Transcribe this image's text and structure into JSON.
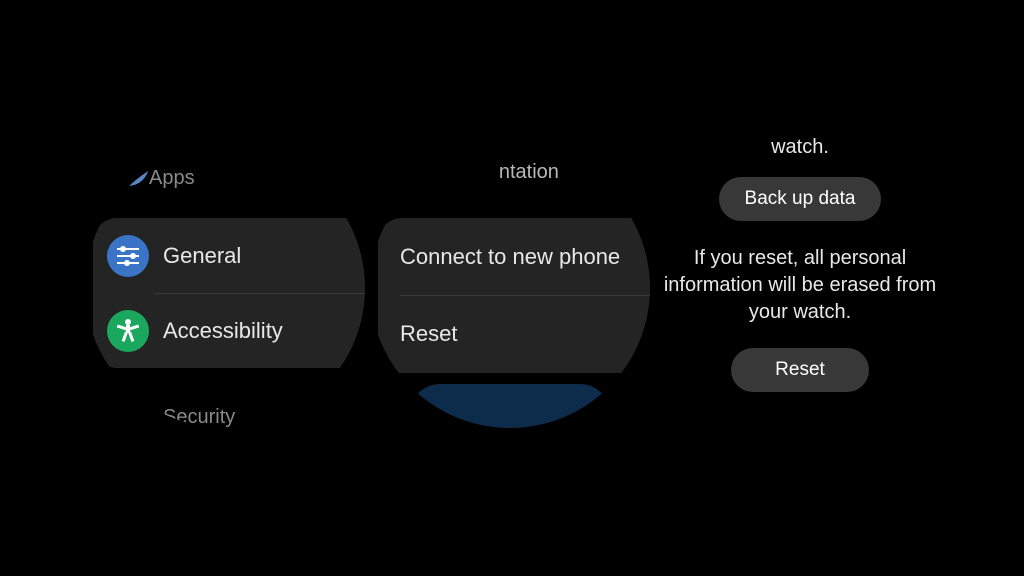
{
  "watch1": {
    "apps_label": "Apps",
    "general_label": "General",
    "accessibility_label": "Accessibility",
    "security_label": "Security",
    "icons": {
      "apps": "apps-icon",
      "general": "sliders-icon",
      "accessibility": "accessibility-icon",
      "security": "lock-icon"
    }
  },
  "watch2": {
    "top_partial": "ntation",
    "connect_label": "Connect to new phone",
    "reset_label": "Reset"
  },
  "watch3": {
    "top_fragment": "watch.",
    "backup_btn": "Back up data",
    "warning_text": "If you reset, all personal information will be erased from your watch.",
    "reset_btn": "Reset"
  },
  "colors": {
    "card_bg": "#242424",
    "pill_bg": "#383838",
    "general_icon_bg": "#3b73c7",
    "accessibility_icon_bg": "#1aa85f"
  }
}
